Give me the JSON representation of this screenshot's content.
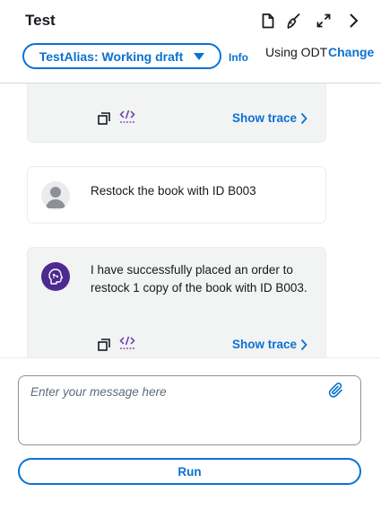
{
  "panel": {
    "title": "Test",
    "alias_label": "TestAlias: Working draft",
    "info_link": "Info",
    "odt_label": "Using ODT",
    "odt_change": "Change"
  },
  "icons": {
    "document": "document-icon",
    "broom": "clear-session-icon",
    "expand": "expand-icon",
    "collapse": "chevron-right-icon",
    "copy": "copy-icon",
    "code": "code-icon",
    "attach": "paperclip-icon"
  },
  "messages": [
    {
      "role": "agent",
      "text": "",
      "show_trace": "Show trace"
    },
    {
      "role": "user",
      "text": "Restock the book with ID B003"
    },
    {
      "role": "agent",
      "text": "I have successfully placed an order to restock 1 copy of the book with ID B003.",
      "show_trace": "Show trace"
    }
  ],
  "composer": {
    "placeholder": "Enter your message here",
    "value": "",
    "run_label": "Run"
  },
  "colors": {
    "accent": "#0972d3",
    "agent_avatar": "#4c2a8f",
    "card_bg": "#f2f3f3"
  }
}
